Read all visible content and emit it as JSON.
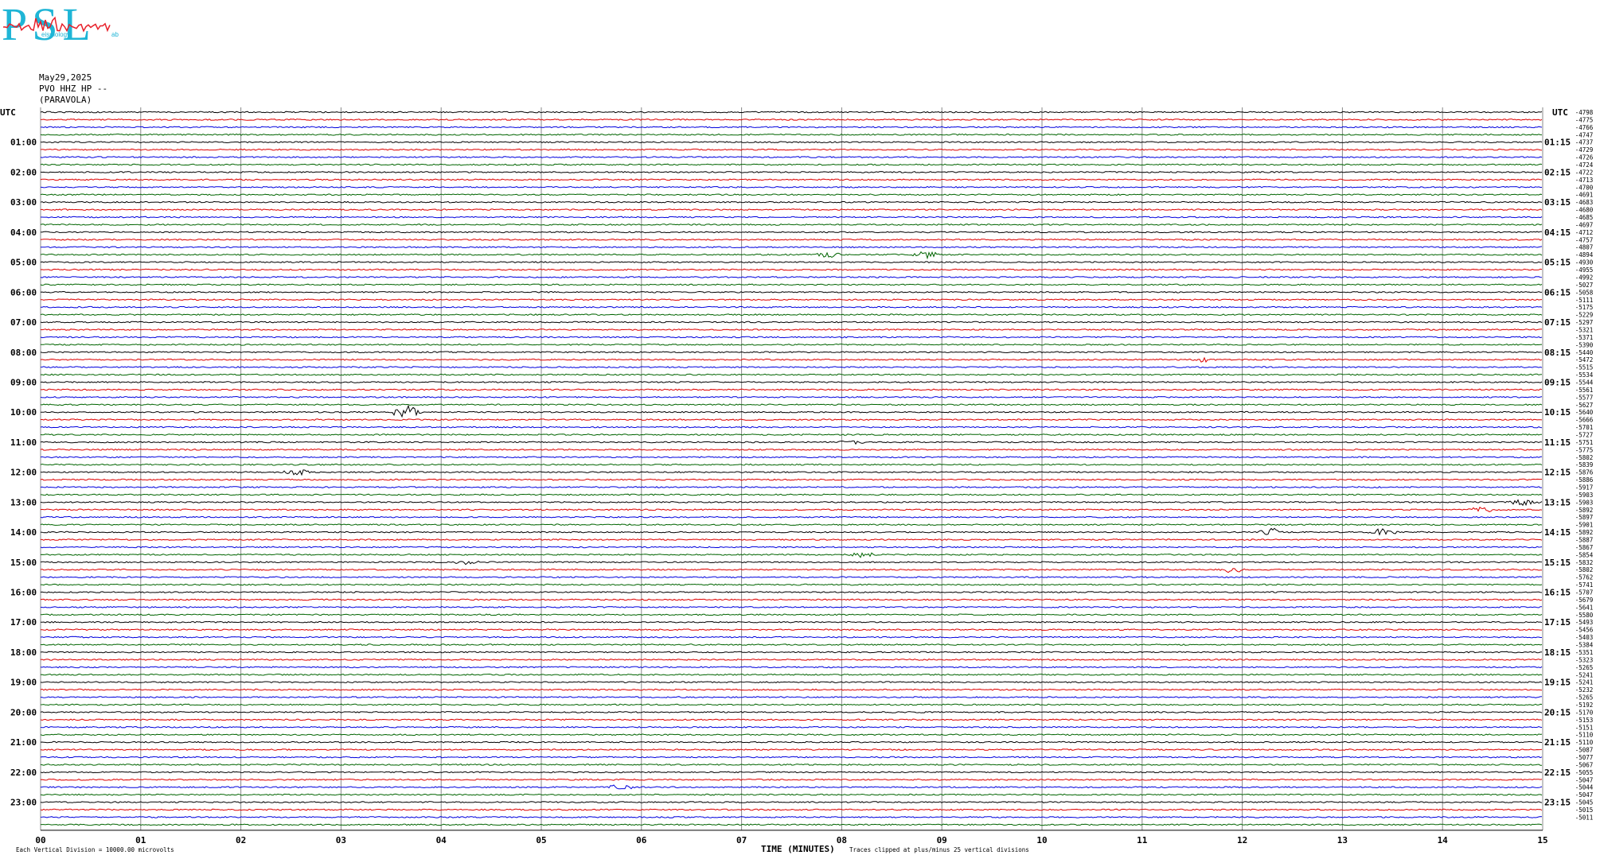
{
  "logo": {
    "letters": "PSL",
    "subtitle_words": [
      "...",
      "eismology",
      "ab"
    ],
    "color_main": "#1fb5d6",
    "color_trace": "#e8202a"
  },
  "header": {
    "date": "May29,2025",
    "station": "PVO HHZ HP --",
    "location": "(PARAVOLA)"
  },
  "chart_data": {
    "type": "line",
    "title": "",
    "xlabel": "TIME (MINUTES)",
    "left_axis_label": "UTC",
    "right_axis_label": "UTC",
    "x_ticks": [
      "00",
      "01",
      "02",
      "03",
      "04",
      "05",
      "06",
      "07",
      "08",
      "09",
      "10",
      "11",
      "12",
      "13",
      "14",
      "15"
    ],
    "xlim": [
      0,
      15
    ],
    "left_hour_labels": [
      "01:00",
      "02:00",
      "03:00",
      "04:00",
      "05:00",
      "06:00",
      "07:00",
      "08:00",
      "09:00",
      "10:00",
      "11:00",
      "12:00",
      "13:00",
      "14:00",
      "15:00",
      "16:00",
      "17:00",
      "18:00",
      "19:00",
      "20:00",
      "21:00",
      "22:00",
      "23:00"
    ],
    "right_hour_labels": [
      "01:15",
      "02:15",
      "03:15",
      "04:15",
      "05:15",
      "06:15",
      "07:15",
      "08:15",
      "09:15",
      "10:15",
      "11:15",
      "12:15",
      "13:15",
      "14:15",
      "15:15",
      "16:15",
      "17:15",
      "18:15",
      "19:15",
      "20:15",
      "21:15",
      "22:15",
      "23:15"
    ],
    "trace_colors": [
      "#000000",
      "#dd0000",
      "#0000dd",
      "#006400"
    ],
    "num_traces": 96,
    "right_values": [
      "-4798",
      "-4775",
      "-4766",
      "-4747",
      "-4737",
      "-4729",
      "-4726",
      "-4724",
      "-4722",
      "-4713",
      "-4700",
      "-4691",
      "-4683",
      "-4680",
      "-4685",
      "-4697",
      "-4712",
      "-4757",
      "-4807",
      "-4894",
      "-4930",
      "-4955",
      "-4992",
      "-5027",
      "-5058",
      "-5111",
      "-5175",
      "-5229",
      "-5297",
      "-5321",
      "-5371",
      "-5390",
      "-5440",
      "-5472",
      "-5515",
      "-5534",
      "-5544",
      "-5561",
      "-5577",
      "-5627",
      "-5640",
      "-5666",
      "-5701",
      "-5727",
      "-5751",
      "-5775",
      "-5802",
      "-5839",
      "-5876",
      "-5886",
      "-5917",
      "-5903",
      "-5903",
      "-5892",
      "-5897",
      "-5901",
      "-5892",
      "-5887",
      "-5867",
      "-5854",
      "-5832",
      "-5802",
      "-5762",
      "-5741",
      "-5707",
      "-5679",
      "-5641",
      "-5580",
      "-5493",
      "-5456",
      "-5403",
      "-5384",
      "-5351",
      "-5323",
      "-5265",
      "-5241",
      "-5241",
      "-5232",
      "-5265",
      "-5192",
      "-5170",
      "-5153",
      "-5151",
      "-5110",
      "-5110",
      "-5087",
      "-5077",
      "-5067",
      "-5055",
      "-5047",
      "-5044",
      "-5047",
      "-5045",
      "-5015",
      "-5011"
    ],
    "footer_left": "Each Vertical Division = 10000.00 microvolts",
    "footer_clip": "Traces clipped at plus/minus 25 vertical divisions",
    "events": [
      {
        "trace": 19,
        "minute": 7.85,
        "amp": 4
      },
      {
        "trace": 19,
        "minute": 8.85,
        "amp": 4
      },
      {
        "trace": 33,
        "minute": 11.6,
        "amp": 3
      },
      {
        "trace": 40,
        "minute": 3.65,
        "amp": 9
      },
      {
        "trace": 44,
        "minute": 8.1,
        "amp": 3
      },
      {
        "trace": 48,
        "minute": 2.55,
        "amp": 6
      },
      {
        "trace": 52,
        "minute": 14.8,
        "amp": 5
      },
      {
        "trace": 53,
        "minute": 14.4,
        "amp": 4
      },
      {
        "trace": 56,
        "minute": 12.3,
        "amp": 6
      },
      {
        "trace": 56,
        "minute": 13.4,
        "amp": 5
      },
      {
        "trace": 59,
        "minute": 8.2,
        "amp": 4
      },
      {
        "trace": 60,
        "minute": 4.25,
        "amp": 3
      },
      {
        "trace": 61,
        "minute": 11.9,
        "amp": 4
      },
      {
        "trace": 90,
        "minute": 5.8,
        "amp": 4
      }
    ]
  }
}
